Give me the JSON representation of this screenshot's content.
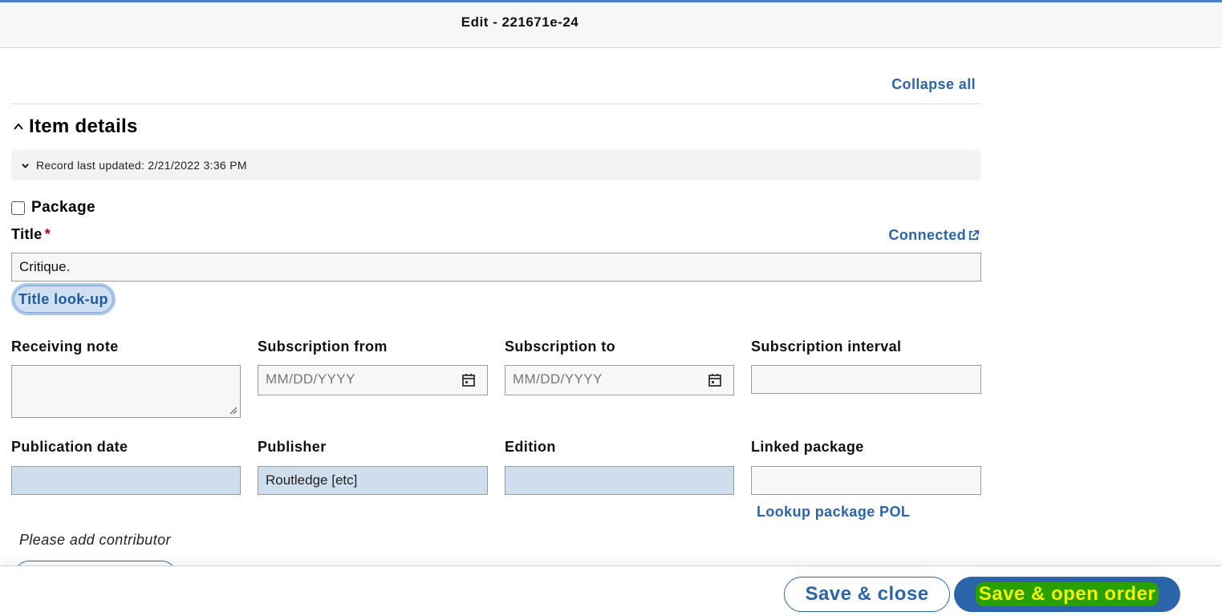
{
  "header": {
    "title": "Edit - 221671e-24"
  },
  "actions": {
    "collapse_all": "Collapse all"
  },
  "section": {
    "title": "Item details",
    "icon": "chevron-up-icon",
    "record_updated": "Record last updated: 2/21/2022 3:36 PM"
  },
  "package": {
    "label": "Package",
    "checked": false
  },
  "title_field": {
    "label": "Title",
    "required_mark": "*",
    "value": "Critique.",
    "connected_label": "Connected",
    "connected_icon": "external-link-icon",
    "lookup_label": "Title look-up"
  },
  "fields": {
    "receiving_note": {
      "label": "Receiving note",
      "value": ""
    },
    "subscription_from": {
      "label": "Subscription from",
      "placeholder": "MM/DD/YYYY"
    },
    "subscription_to": {
      "label": "Subscription to",
      "placeholder": "MM/DD/YYYY"
    },
    "subscription_interval": {
      "label": "Subscription interval",
      "value": ""
    },
    "publication_date": {
      "label": "Publication date",
      "value": ""
    },
    "publisher": {
      "label": "Publisher",
      "value": "Routledge [etc]"
    },
    "edition": {
      "label": "Edition",
      "value": ""
    },
    "linked_package": {
      "label": "Linked package",
      "value": "",
      "lookup_label": "Lookup package POL"
    }
  },
  "contributors": {
    "note": "Please add contributor"
  },
  "footer": {
    "save_close": "Save & close",
    "save_open_order": "Save & open order"
  },
  "colors": {
    "accent": "#2b64a9",
    "prefilled_field": "#cfdeec",
    "highlight_bg": "#27a000",
    "highlight_text": "#f4f000"
  }
}
